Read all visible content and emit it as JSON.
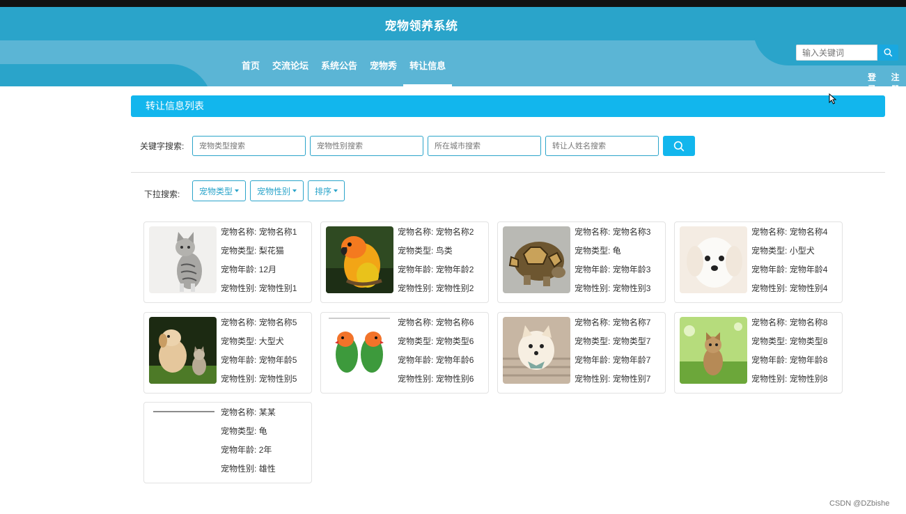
{
  "header": {
    "site_title": "宠物领养系统",
    "nav": [
      "首页",
      "交流论坛",
      "系统公告",
      "宠物秀",
      "转让信息"
    ],
    "search_placeholder": "输入关键词",
    "login": "登录",
    "register": "注册"
  },
  "section": {
    "title": "转让信息列表"
  },
  "keyword_search": {
    "label": "关键字搜索:",
    "placeholders": [
      "宠物类型搜索",
      "宠物性别搜索",
      "所在城市搜索",
      "转让人姓名搜索"
    ]
  },
  "dropdown_search": {
    "label": "下拉搜索:",
    "buttons": [
      "宠物类型",
      "宠物性别",
      "排序"
    ]
  },
  "field_labels": {
    "name": "宠物名称:",
    "type": "宠物类型:",
    "age": "宠物年龄:",
    "gender": "宠物性别:"
  },
  "pets": [
    {
      "name": "宠物名称1",
      "type": "梨花猫",
      "age": "12月",
      "gender": "宠物性别1",
      "image": "cat-icon"
    },
    {
      "name": "宠物名称2",
      "type": "鸟类",
      "age": "宠物年龄2",
      "gender": "宠物性别2",
      "image": "parrot-icon"
    },
    {
      "name": "宠物名称3",
      "type": "龟",
      "age": "宠物年龄3",
      "gender": "宠物性别3",
      "image": "tortoise-icon"
    },
    {
      "name": "宠物名称4",
      "type": "小型犬",
      "age": "宠物年龄4",
      "gender": "宠物性别4",
      "image": "white-dog-icon"
    },
    {
      "name": "宠物名称5",
      "type": "大型犬",
      "age": "宠物年龄5",
      "gender": "宠物性别5",
      "image": "puppy-kitten-icon"
    },
    {
      "name": "宠物名称6",
      "type": "宠物类型6",
      "age": "宠物年龄6",
      "gender": "宠物性别6",
      "image": "lovebirds-icon"
    },
    {
      "name": "宠物名称7",
      "type": "宠物类型7",
      "age": "宠物年龄7",
      "gender": "宠物性别7",
      "image": "pomeranian-icon"
    },
    {
      "name": "宠物名称8",
      "type": "宠物类型8",
      "age": "宠物年龄8",
      "gender": "宠物性别8",
      "image": "kitten-grass-icon"
    },
    {
      "name": "某某",
      "type": "龟",
      "age": "2年",
      "gender": "雄性",
      "image": "blank-image-icon"
    }
  ],
  "watermark": "CSDN @DZbishe",
  "colors": {
    "header_dark": "#2aa4ca",
    "header_light": "#5bb5d5",
    "accent": "#12b6ed"
  }
}
